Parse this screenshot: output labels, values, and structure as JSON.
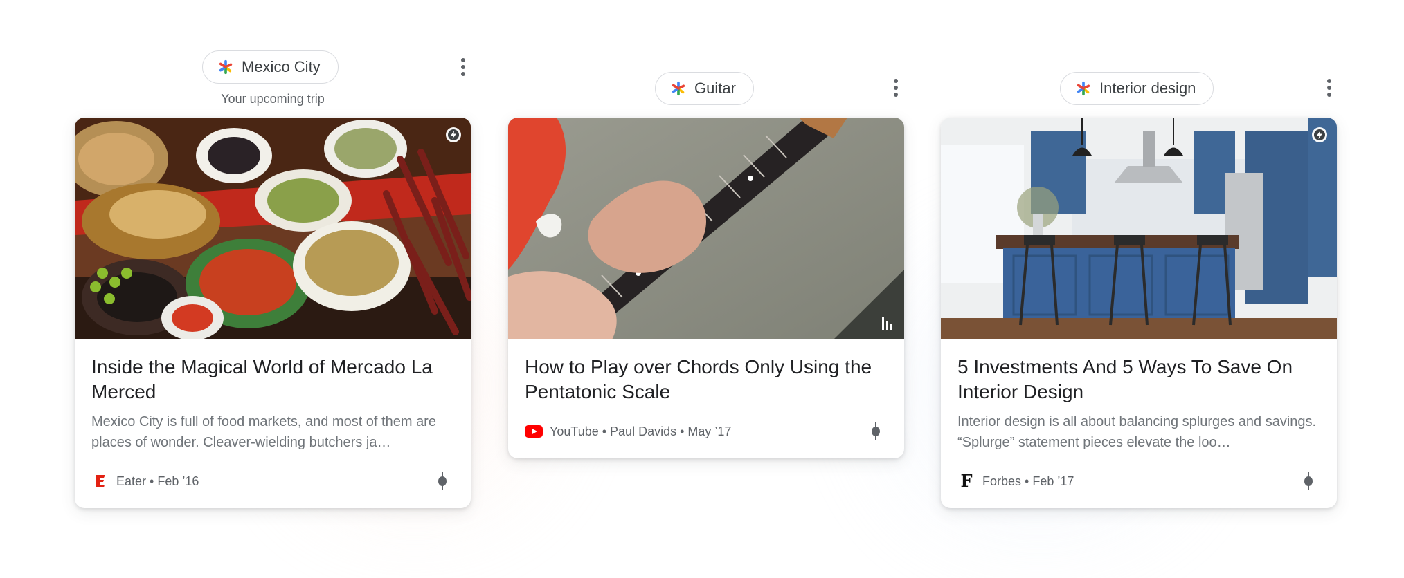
{
  "colors": {
    "title_text": "#202124",
    "secondary_text": "#5f6368",
    "snippet_text": "#70757a",
    "chip_border": "#dadce0",
    "eater_red": "#e32112",
    "youtube_red": "#ff0000",
    "spark_blue": "#4285f4",
    "spark_red": "#ea4335",
    "spark_yellow": "#fbbc04",
    "spark_green": "#34a853"
  },
  "columns": [
    {
      "topic": "Mexico City",
      "subtitle": "Your upcoming trip",
      "card": {
        "image_subject": "market-food-stall-photo",
        "title": "Inside the Magical World of Mercado La Merced",
        "snippet": "Mexico City is full of food markets, and most of them are places of wonder. Cleaver-wielding butchers ja…",
        "source_icon": "eater-logo-icon",
        "meta": "Eater • Feb ’16"
      }
    },
    {
      "topic": "Guitar",
      "card": {
        "image_subject": "electric-guitar-video-thumbnail",
        "title": "How to Play over Chords Only Using the Pentatonic Scale",
        "source_icon": "youtube-logo-icon",
        "meta": "YouTube • Paul Davids • May ’17"
      }
    },
    {
      "topic": "Interior design",
      "card": {
        "image_subject": "blue-kitchen-interior-photo",
        "title": "5 Investments And 5 Ways To Save On Interior Design",
        "snippet": "Interior design is all about balancing splurges and savings. “Splurge” statement pieces elevate the loo…",
        "source_icon": "forbes-logo-icon",
        "source_icon_letter": "F",
        "meta": "Forbes • Feb ’17"
      }
    }
  ]
}
